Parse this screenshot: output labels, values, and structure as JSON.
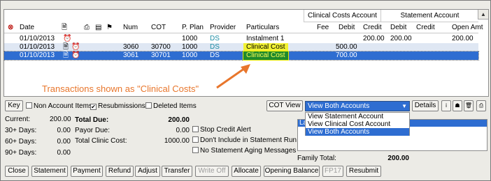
{
  "grid": {
    "group_headers": {
      "clinical": "Clinical Costs Account",
      "statement": "Statement Account"
    },
    "columns": {
      "date": "Date",
      "num": "Num",
      "cot": "COT",
      "pplan": "P. Plan",
      "provider": "Provider",
      "particulars": "Particulars",
      "fee": "Fee",
      "debit": "Debit",
      "credit": "Credit",
      "s_debit": "Debit",
      "s_credit": "Credit",
      "open_amt": "Open Amt"
    },
    "rows": [
      {
        "date": "01/10/2013",
        "num": "",
        "cot": "",
        "pplan": "1000",
        "provider": "DS",
        "particulars": "Instalment 1",
        "fee": "",
        "debit": "",
        "credit": "200.00",
        "s_debit": "200.00",
        "s_credit": "",
        "open_amt": "200.00"
      },
      {
        "date": "01/10/2013",
        "num": "3060",
        "cot": "30700",
        "pplan": "1000",
        "provider": "DS",
        "particulars": "Clinical Cost",
        "fee": "",
        "debit": "500.00",
        "credit": "",
        "s_debit": "",
        "s_credit": "",
        "open_amt": ""
      },
      {
        "date": "01/10/2013",
        "num": "3061",
        "cot": "30701",
        "pplan": "1000",
        "provider": "DS",
        "particulars": "Clinical Cost",
        "fee": "",
        "debit": "700.00",
        "credit": "",
        "s_debit": "",
        "s_credit": "",
        "open_amt": ""
      }
    ]
  },
  "annotation": "Transactions shown as \"Clinical Costs\"",
  "toolbar": {
    "key": "Key",
    "non_account": "Non Account Items",
    "resubmissions": "Resubmissions",
    "deleted": "Deleted Items",
    "cot_view": "COT View",
    "view_select": "View Both Accounts",
    "details": "Details",
    "checks": {
      "non_account": false,
      "resubmissions": true,
      "deleted": false
    }
  },
  "view_options": [
    "View Statement Account",
    "View Clinical Cost Account",
    "View Both Accounts"
  ],
  "aging": [
    {
      "label": "Current:",
      "value": "200.00"
    },
    {
      "label": "30+ Days:",
      "value": "0.00"
    },
    {
      "label": "60+ Days:",
      "value": "0.00"
    },
    {
      "label": "90+ Days:",
      "value": "0.00"
    }
  ],
  "totals": {
    "total_due_label": "Total Due:",
    "total_due": "200.00",
    "payor_due_label": "Payor Due:",
    "payor_due": "0.00",
    "clinic_cost_label": "Total Clinic Cost:",
    "clinic_cost": "1000.00"
  },
  "options": {
    "stop_credit": "Stop Credit Alert",
    "dont_include": "Don't Include in Statement Run",
    "no_aging": "No Statement Aging Messages"
  },
  "family": {
    "label": "Family Total:",
    "value": "200.00"
  },
  "listbox_text": "La",
  "buttons": [
    "Close",
    "Statement",
    "Payment",
    "Refund",
    "Adjust",
    "Transfer",
    "Write Off",
    "Allocate",
    "Opening Balance",
    "FP17",
    "Resubmit"
  ],
  "colors": {
    "annotation": "#e8762c",
    "selection": "#2e6dd1",
    "highlight": "#f2f233"
  }
}
